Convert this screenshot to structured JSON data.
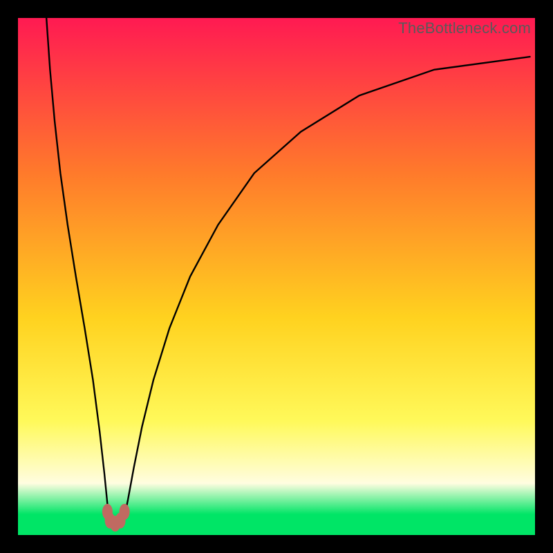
{
  "watermark": "TheBottleneck.com",
  "colors": {
    "frame": "#000000",
    "grad_top": "#ff1a52",
    "grad_mid1": "#ff7a2b",
    "grad_mid2": "#ffd21f",
    "grad_mid3": "#fff95a",
    "grad_band": "#fffde0",
    "grad_bottom": "#00e566",
    "curve": "#000000",
    "marker": "#c06a61"
  },
  "chart_data": {
    "type": "line",
    "title": "",
    "xlabel": "",
    "ylabel": "",
    "xlim": [
      0,
      1
    ],
    "ylim": [
      0,
      1
    ],
    "legend": false,
    "grid": false,
    "series": [
      {
        "name": "left-branch",
        "x": [
          0.055,
          0.062,
          0.071,
          0.082,
          0.096,
          0.112,
          0.129,
          0.145,
          0.158,
          0.167,
          0.173,
          0.178
        ],
        "y": [
          1.0,
          0.9,
          0.8,
          0.7,
          0.6,
          0.5,
          0.4,
          0.3,
          0.2,
          0.12,
          0.06,
          0.03
        ]
      },
      {
        "name": "right-branch",
        "x": [
          0.205,
          0.213,
          0.224,
          0.24,
          0.262,
          0.293,
          0.333,
          0.387,
          0.457,
          0.547,
          0.66,
          0.805,
          0.99
        ],
        "y": [
          0.03,
          0.07,
          0.13,
          0.21,
          0.3,
          0.4,
          0.5,
          0.6,
          0.7,
          0.78,
          0.85,
          0.9,
          0.925
        ]
      }
    ],
    "markers": [
      {
        "name": "valley-left-top",
        "x": 0.173,
        "y": 0.045
      },
      {
        "name": "valley-left-mid",
        "x": 0.178,
        "y": 0.028
      },
      {
        "name": "valley-center",
        "x": 0.188,
        "y": 0.022
      },
      {
        "name": "valley-right-mid",
        "x": 0.198,
        "y": 0.028
      },
      {
        "name": "valley-right-top",
        "x": 0.206,
        "y": 0.045
      }
    ],
    "minimum_x": 0.19
  }
}
